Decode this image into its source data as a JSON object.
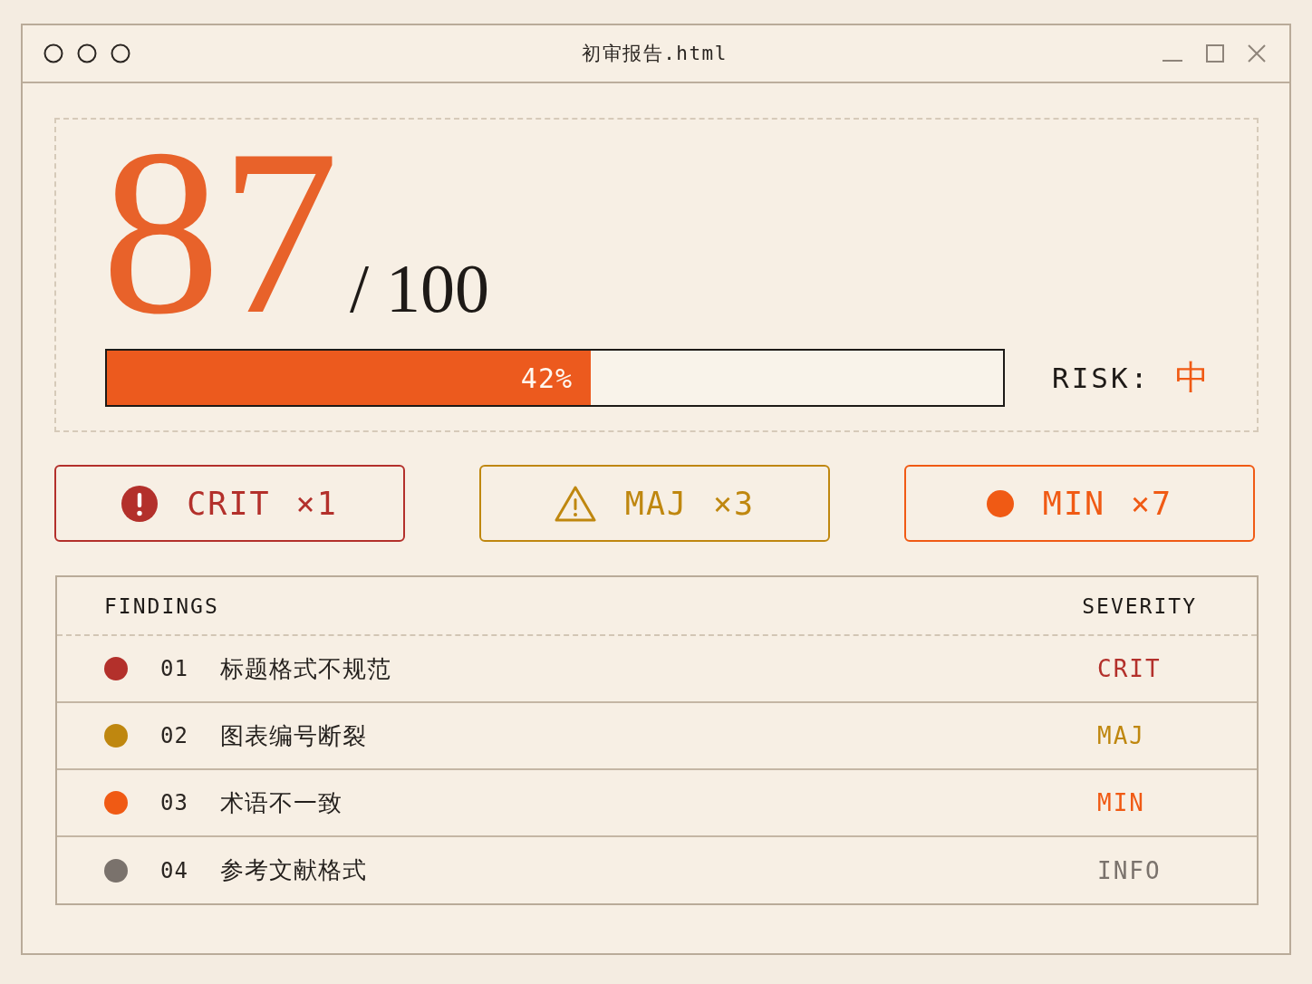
{
  "window": {
    "title": "初审报告.html"
  },
  "score": {
    "value": "87",
    "total": "/ 100",
    "progress": {
      "level": 0.54,
      "label": "42%"
    },
    "risk": {
      "label": "RISK:",
      "value": "中"
    }
  },
  "severity_summary": [
    {
      "kind": "critical",
      "label": "CRIT",
      "count": "×1",
      "color": "#b3302b"
    },
    {
      "kind": "major",
      "label": "MAJ",
      "count": "×3",
      "color": "#bf870f"
    },
    {
      "kind": "minor",
      "label": "MIN",
      "count": "×7",
      "color": "#f05a14"
    }
  ],
  "findings": {
    "columns": [
      "FINDINGS",
      "SEVERITY"
    ],
    "rows": [
      {
        "number": "01",
        "title": "标题格式不规范",
        "severity": "CRIT",
        "color": "#b3302b"
      },
      {
        "number": "02",
        "title": "图表编号断裂",
        "severity": "MAJ",
        "color": "#bf870f"
      },
      {
        "number": "03",
        "title": "术语不一致",
        "severity": "MIN",
        "color": "#f05a14"
      },
      {
        "number": "04",
        "title": "参考文献格式",
        "severity": "INFO",
        "color": "#7a726c"
      }
    ]
  }
}
